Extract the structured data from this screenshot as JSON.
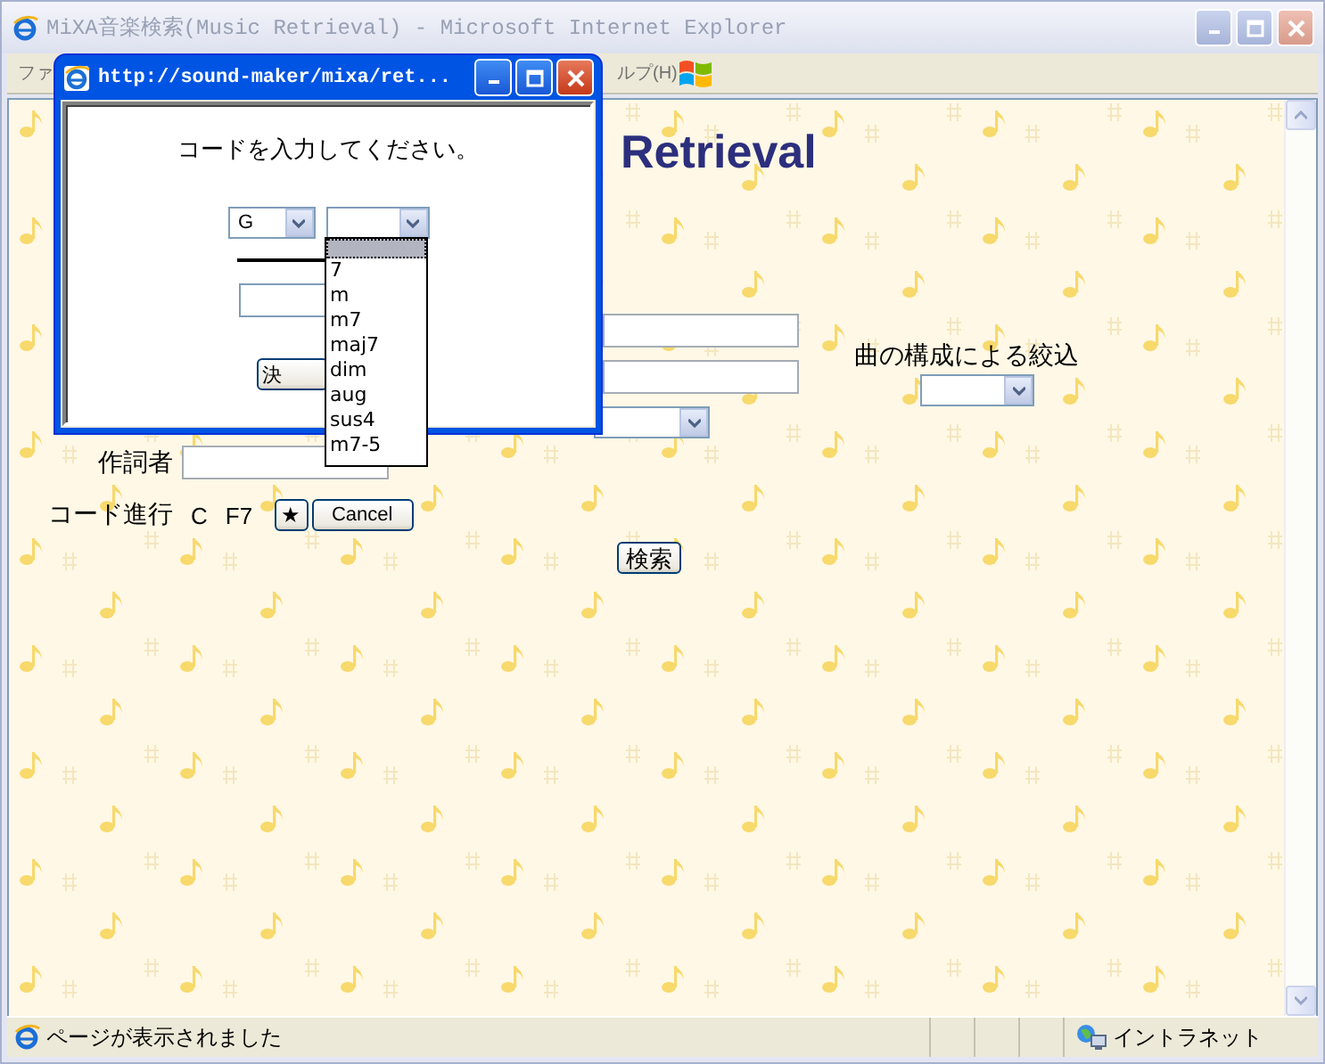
{
  "main_window": {
    "title": "MiXA音楽検索(Music Retrieval) - Microsoft Internet Explorer",
    "active": false,
    "menu": [
      "ファ",
      "ルプ(H)"
    ]
  },
  "page": {
    "heading": "Retrieval",
    "filter_label": "曲の構成による絞込",
    "lyricist_label": "作詞者",
    "chord_progression_label": "コード進行",
    "chords": [
      "C",
      "F7"
    ],
    "star_button": "★",
    "cancel_button": "Cancel",
    "search_button": "検索"
  },
  "status_bar": {
    "message": "ページが表示されました",
    "zone": "イントラネット"
  },
  "popup": {
    "title": "http://sound-maker/mixa/ret...",
    "active": true,
    "prompt": "コードを入力してください。",
    "root_select": "G",
    "confirm_button": "決"
  },
  "dropdown": {
    "blank_option": {
      "selected": true
    },
    "options": [
      {
        "label": "7",
        "selected": false
      },
      {
        "label": "m",
        "selected": false
      },
      {
        "label": "m7",
        "selected": false
      },
      {
        "label": "maj7",
        "selected": false
      },
      {
        "label": "dim",
        "selected": false
      },
      {
        "label": "aug",
        "selected": false
      },
      {
        "label": "sus4",
        "selected": false
      },
      {
        "label": "m7-5",
        "selected": false
      }
    ]
  }
}
